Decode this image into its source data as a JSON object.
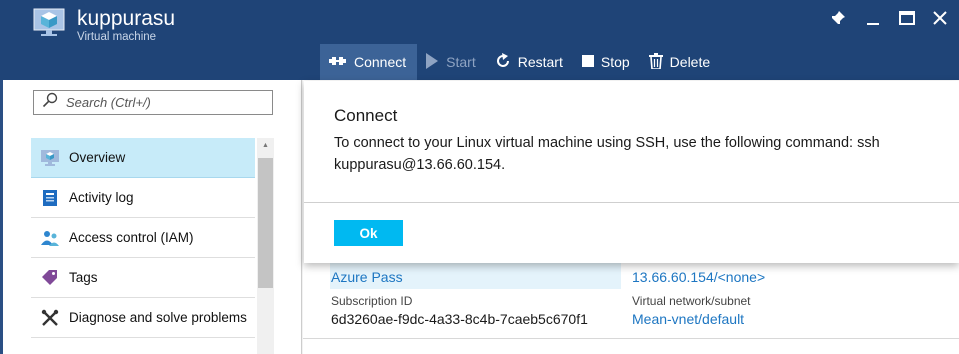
{
  "header": {
    "title": "kuppurasu",
    "subtitle": "Virtual machine",
    "logo_icon": "virtual-machine-icon",
    "window_controls": [
      "pin-icon",
      "minimize-icon",
      "maximize-icon",
      "close-icon"
    ]
  },
  "toolbar": {
    "items": [
      {
        "label": "Connect",
        "icon": "connect-icon",
        "state": "active"
      },
      {
        "label": "Start",
        "icon": "play-icon",
        "state": "disabled"
      },
      {
        "label": "Restart",
        "icon": "restart-icon",
        "state": "enabled"
      },
      {
        "label": "Stop",
        "icon": "stop-icon",
        "state": "enabled"
      },
      {
        "label": "Delete",
        "icon": "trash-icon",
        "state": "enabled"
      }
    ]
  },
  "search": {
    "placeholder": "Search (Ctrl+/)",
    "value": ""
  },
  "menu": {
    "items": [
      {
        "label": "Overview",
        "icon": "overview-icon",
        "selected": true
      },
      {
        "label": "Activity log",
        "icon": "activity-log-icon",
        "selected": false
      },
      {
        "label": "Access control (IAM)",
        "icon": "access-control-icon",
        "selected": false
      },
      {
        "label": "Tags",
        "icon": "tag-icon",
        "selected": false
      },
      {
        "label": "Diagnose and solve problems",
        "icon": "wrench-icon",
        "selected": false
      }
    ]
  },
  "essentials": {
    "subscription_name_value": "Azure Pass",
    "public_ip_value": "13.66.60.154/<none>",
    "subscription_id_label": "Subscription ID",
    "subscription_id_value": "6d3260ae-f9dc-4a33-8c4b-7caeb5c670f1",
    "vnet_label": "Virtual network/subnet",
    "vnet_value": "Mean-vnet/default"
  },
  "dialog": {
    "title": "Connect",
    "message": "To connect to your Linux virtual machine using SSH, use the following command: ssh kuppurasu@13.66.60.154.",
    "ok_label": "Ok"
  },
  "colors": {
    "header_bg": "#1f4477",
    "active_toolbar_bg": "#3c6397",
    "selected_item_bg": "#c7ebf9",
    "ok_button_bg": "#00b9f1",
    "link": "#1d76c2"
  }
}
